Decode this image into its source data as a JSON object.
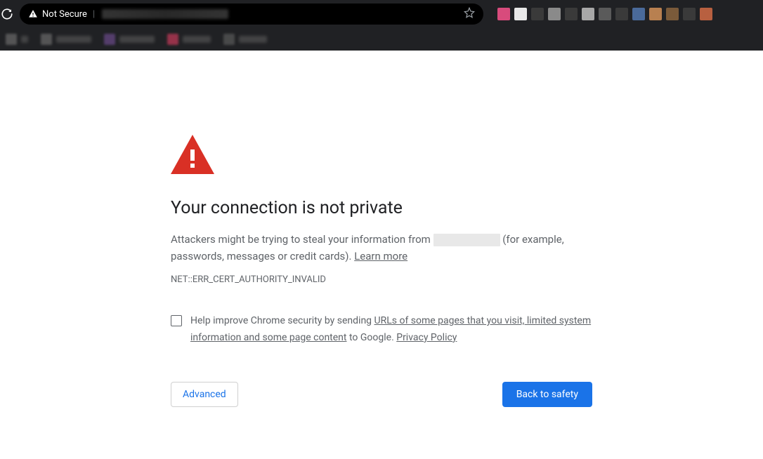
{
  "chrome": {
    "not_secure_label": "Not Secure",
    "tab_colors": [
      "#d84b7c",
      "#e8e8e8",
      "#3a3a3a",
      "#8a8a8a",
      "#3a3a3a",
      "#a8a8a8",
      "#5a5a5a",
      "#3a3a3a",
      "#4a6a9a",
      "#b88050",
      "#7a5a3a",
      "#3a3a3a",
      "#b86040"
    ]
  },
  "page": {
    "title": "Your connection is not private",
    "body_prefix": "Attackers might be trying to steal your information from ",
    "body_suffix": " (for example, passwords, messages or credit cards). ",
    "learn_more": "Learn more",
    "error_code": "NET::ERR_CERT_AUTHORITY_INVALID",
    "checkbox_prefix": "Help improve Chrome security by sending ",
    "checkbox_link1": "URLs of some pages that you visit, limited system information and some page content",
    "checkbox_mid": " to Google. ",
    "checkbox_link2": "Privacy Policy",
    "advanced_btn": "Advanced",
    "safety_btn": "Back to safety"
  }
}
